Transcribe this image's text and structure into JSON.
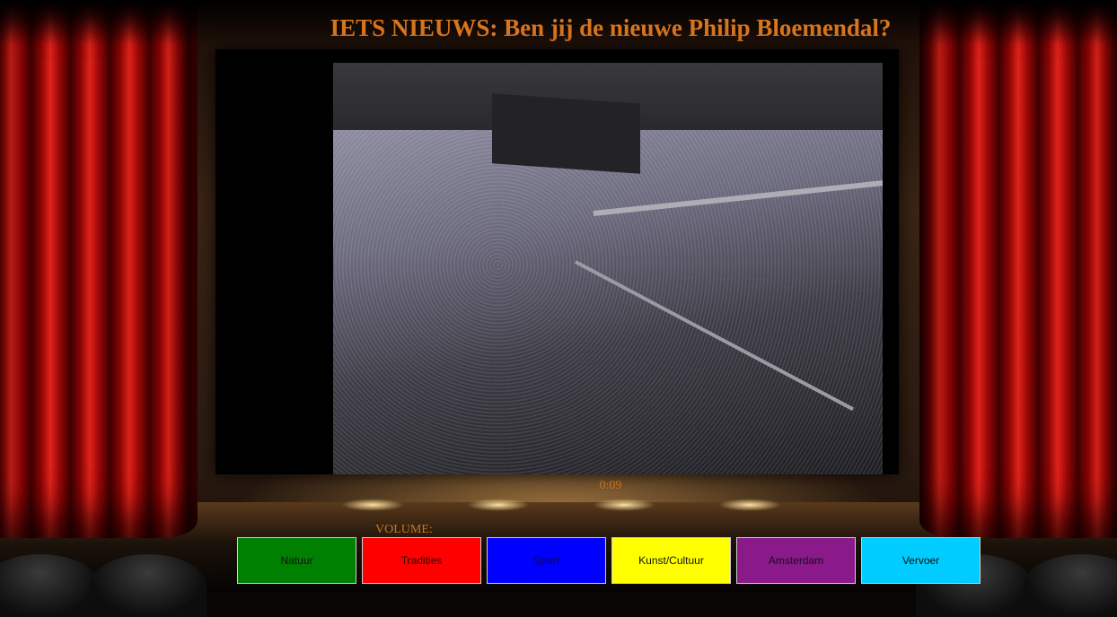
{
  "page": {
    "title": "IETS NIEUWS: Ben jij de nieuwe Philip Bloemendal?"
  },
  "player": {
    "time": "0:09",
    "volume_label": "VOLUME:"
  },
  "categories": [
    {
      "label": "Natuur",
      "color": "#008000"
    },
    {
      "label": "Tradities",
      "color": "#ff0000"
    },
    {
      "label": "Sport",
      "color": "#0000ff"
    },
    {
      "label": "Kunst/Cultuur",
      "color": "#ffff00"
    },
    {
      "label": "Amsterdam",
      "color": "#8a1a8a"
    },
    {
      "label": "Vervoer",
      "color": "#00ccff"
    }
  ]
}
